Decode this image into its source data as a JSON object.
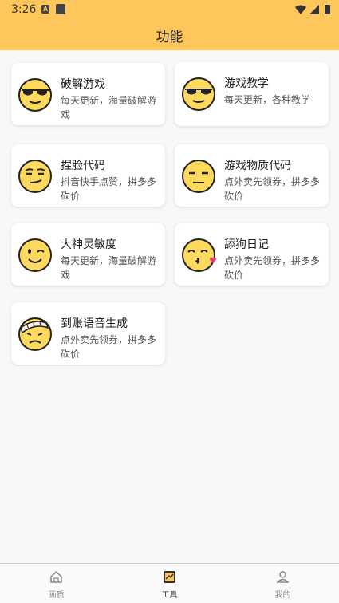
{
  "status": {
    "time": "3:26",
    "a_badge": "A"
  },
  "header": {
    "title": "功能"
  },
  "cards": [
    {
      "title": "破解游戏",
      "desc": "每天更新，海量破解游戏",
      "icon": "sunglasses-face-icon"
    },
    {
      "title": "游戏教学",
      "desc": "每天更新，各种教学",
      "icon": "sunglasses-face-icon"
    },
    {
      "title": "捏脸代码",
      "desc": "抖音快手点赞，拼多多砍价",
      "icon": "smirk-face-icon"
    },
    {
      "title": "游戏物质代码",
      "desc": "点外卖先领券，拼多多砍价",
      "icon": "expressionless-face-icon"
    },
    {
      "title": "大神灵敏度",
      "desc": "每天更新，海量破解游戏",
      "icon": "wink-face-icon"
    },
    {
      "title": "舔狗日记",
      "desc": "点外卖先领券，拼多多砍价",
      "icon": "kiss-face-icon"
    },
    {
      "title": "到账语音生成",
      "desc": "点外卖先领券，拼多多砍价",
      "icon": "bandaged-face-icon"
    }
  ],
  "tabs": [
    {
      "label": "画质",
      "icon": "home-icon"
    },
    {
      "label": "工具",
      "icon": "tools-icon",
      "active": true
    },
    {
      "label": "我的",
      "icon": "user-icon"
    }
  ],
  "colors": {
    "accent": "#ffc65c",
    "face": "#fdd95e"
  }
}
